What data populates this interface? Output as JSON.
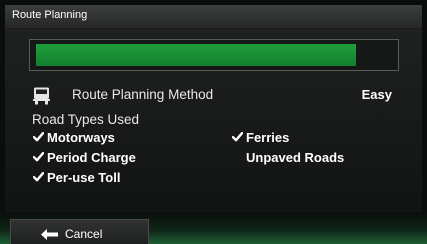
{
  "window": {
    "title": "Route Planning"
  },
  "progress": {
    "value_fraction": 0.9,
    "color": "#1f9e3c"
  },
  "method": {
    "icon": "truck-icon",
    "label": "Route Planning Method",
    "value": "Easy"
  },
  "road_types": {
    "label": "Road Types Used",
    "options": [
      {
        "label": "Motorways",
        "checked": true
      },
      {
        "label": "Ferries",
        "checked": true
      },
      {
        "label": "Period Charge",
        "checked": true
      },
      {
        "label": "Unpaved Roads",
        "checked": false
      },
      {
        "label": "Per-use Toll",
        "checked": true
      }
    ]
  },
  "footer": {
    "cancel_label": "Cancel",
    "cancel_icon": "back-arrow-icon"
  },
  "colors": {
    "accent_green": "#1f9e3c",
    "check_mark": "#ffffff"
  }
}
